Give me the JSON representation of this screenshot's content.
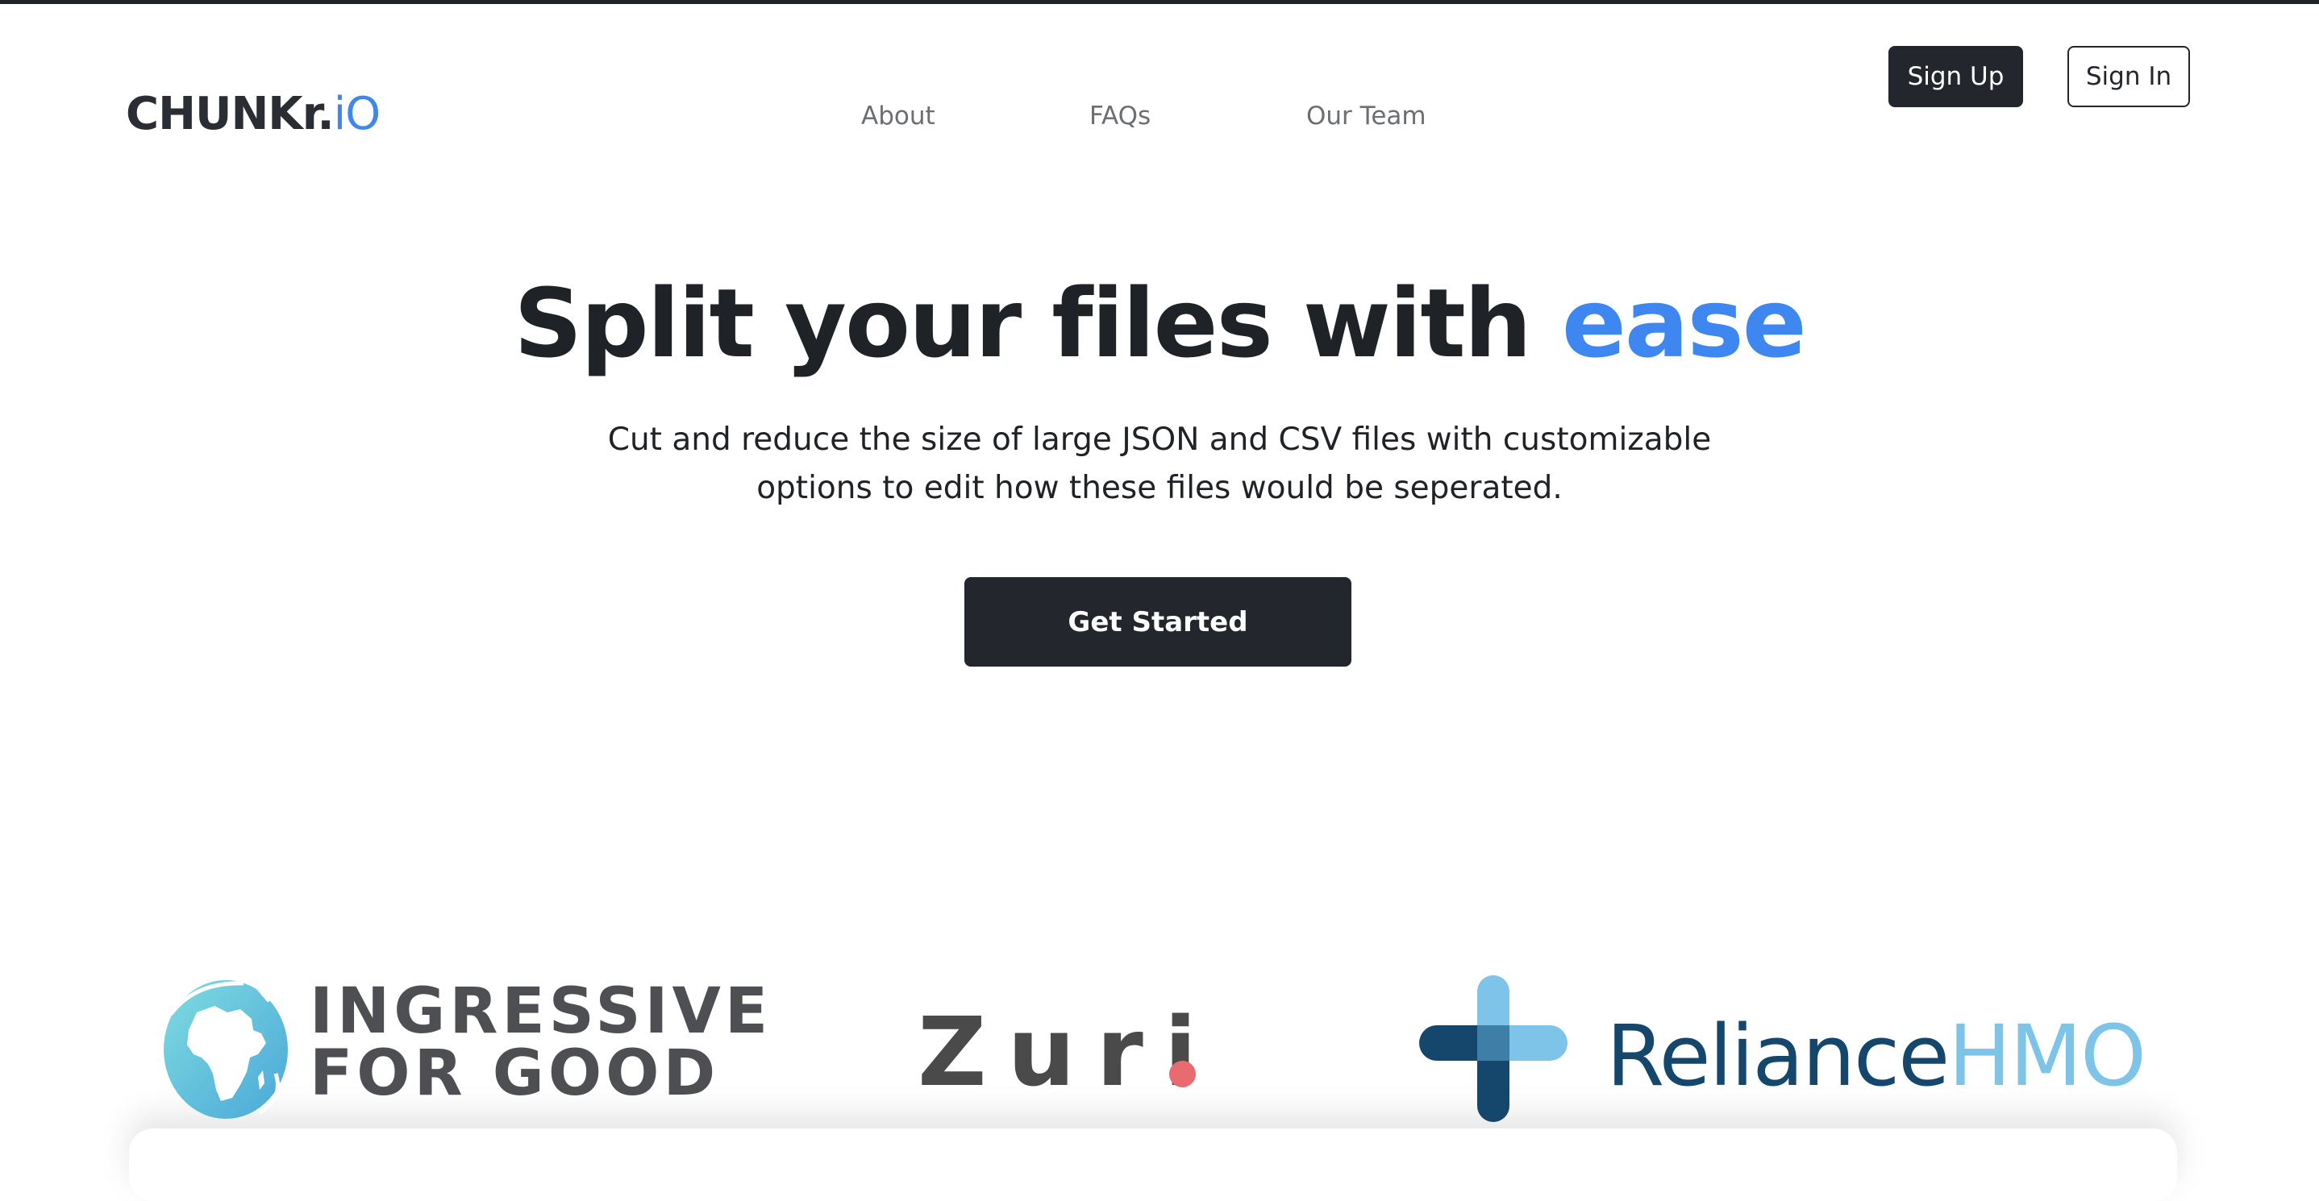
{
  "header": {
    "logo": {
      "main": "CHUNKr.",
      "accent": "iO"
    },
    "nav": [
      {
        "label": "About"
      },
      {
        "label": "FAQs"
      },
      {
        "label": "Our Team"
      }
    ],
    "signup_label": "Sign Up",
    "signin_label": "Sign In"
  },
  "hero": {
    "title_main": "Split your files with ",
    "title_accent": "ease",
    "subtitle": "Cut and reduce the size of large JSON and CSV files with customizable options to edit how these files would be seperated.",
    "cta_label": "Get Started"
  },
  "partners": {
    "ingressive": {
      "line1": "INGRESSIVE",
      "line2": "FOR GOOD"
    },
    "zuri": {
      "name": "Zuri"
    },
    "reliance": {
      "main": "Reliance",
      "accent": "HMO"
    }
  },
  "colors": {
    "accent": "#3f87f0",
    "dark": "#23262c",
    "nav_text": "#6b6e73",
    "zuri_dot": "#e76b6f",
    "reliance_dark": "#15476c",
    "reliance_light": "#7ec3e8"
  },
  "icons": [
    "africa-globe-icon",
    "medical-cross-icon"
  ]
}
